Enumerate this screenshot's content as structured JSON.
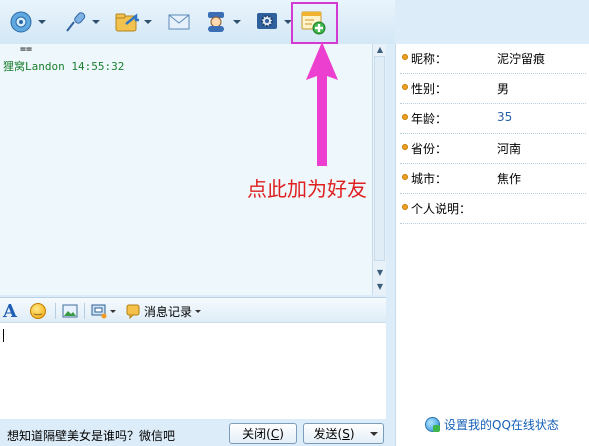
{
  "chat": {
    "line1": "==",
    "line2": "狸窝Landon  14:55:32"
  },
  "annotation": {
    "text": "点此加为好友",
    "color": "#e02020"
  },
  "toolbar": {
    "icons": [
      "video-call-icon",
      "voice-call-icon",
      "send-file-icon",
      "email-icon",
      "create-group-icon",
      "settings-icon",
      "add-friend-icon"
    ],
    "highlight_color": "#d23ad2"
  },
  "input_toolbar": {
    "message_record": "消息记录"
  },
  "bottom": {
    "ad_text": "想知道隔壁美女是谁吗？微信吧",
    "close_label": "关闭",
    "close_key": "C",
    "send_label": "发送",
    "send_key": "S"
  },
  "info": {
    "rows": [
      {
        "label": "昵称：",
        "value": "泥泞留痕"
      },
      {
        "label": "性别：",
        "value": "男"
      },
      {
        "label": "年龄：",
        "value": "35"
      },
      {
        "label": "省份：",
        "value": "河南"
      },
      {
        "label": "城市：",
        "value": "焦作"
      },
      {
        "label": "个人说明：",
        "value": ""
      }
    ],
    "status_link": "设置我的QQ在线状态"
  }
}
